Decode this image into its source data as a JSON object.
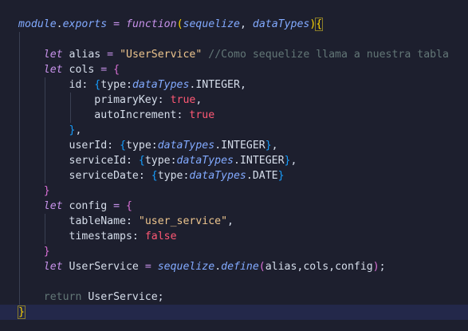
{
  "editor": {
    "lines": [
      {
        "tokens": [
          {
            "t": "module",
            "c": "module"
          },
          {
            "t": ".",
            "c": "plain"
          },
          {
            "t": "exports",
            "c": "module"
          },
          {
            "t": " ",
            "c": "plain"
          },
          {
            "t": "=",
            "c": "op"
          },
          {
            "t": " ",
            "c": "plain"
          },
          {
            "t": "function",
            "c": "kw"
          },
          {
            "t": "(",
            "c": "brace"
          },
          {
            "t": "sequelize",
            "c": "param"
          },
          {
            "t": ", ",
            "c": "plain"
          },
          {
            "t": "dataTypes",
            "c": "param"
          },
          {
            "t": ")",
            "c": "brace"
          },
          {
            "t": "{",
            "c": "bracket-hl"
          }
        ]
      },
      {
        "tokens": []
      },
      {
        "tokens": [
          {
            "t": "    ",
            "c": "plain"
          },
          {
            "t": "let",
            "c": "kw"
          },
          {
            "t": " alias ",
            "c": "plain"
          },
          {
            "t": "=",
            "c": "op"
          },
          {
            "t": " ",
            "c": "plain"
          },
          {
            "t": "\"UserService\"",
            "c": "str"
          },
          {
            "t": " ",
            "c": "plain"
          },
          {
            "t": "//Como sequelize llama a nuestra tabla",
            "c": "comment"
          }
        ]
      },
      {
        "tokens": [
          {
            "t": "    ",
            "c": "plain"
          },
          {
            "t": "let",
            "c": "kw"
          },
          {
            "t": " cols ",
            "c": "plain"
          },
          {
            "t": "=",
            "c": "op"
          },
          {
            "t": " ",
            "c": "plain"
          },
          {
            "t": "{",
            "c": "brace2"
          }
        ]
      },
      {
        "tokens": [
          {
            "t": "        ",
            "c": "plain"
          },
          {
            "t": "id: ",
            "c": "prop"
          },
          {
            "t": "{",
            "c": "brace3"
          },
          {
            "t": "type:",
            "c": "prop"
          },
          {
            "t": "dataTypes",
            "c": "param"
          },
          {
            "t": ".INTEGER,",
            "c": "plain"
          }
        ]
      },
      {
        "tokens": [
          {
            "t": "            ",
            "c": "plain"
          },
          {
            "t": "primaryKey: ",
            "c": "prop"
          },
          {
            "t": "true",
            "c": "bool"
          },
          {
            "t": ",",
            "c": "plain"
          }
        ]
      },
      {
        "tokens": [
          {
            "t": "            ",
            "c": "plain"
          },
          {
            "t": "autoIncrement: ",
            "c": "prop"
          },
          {
            "t": "true",
            "c": "bool"
          }
        ]
      },
      {
        "tokens": [
          {
            "t": "        ",
            "c": "plain"
          },
          {
            "t": "}",
            "c": "brace3"
          },
          {
            "t": ",",
            "c": "plain"
          }
        ]
      },
      {
        "tokens": [
          {
            "t": "        ",
            "c": "plain"
          },
          {
            "t": "userId: ",
            "c": "prop"
          },
          {
            "t": "{",
            "c": "brace3"
          },
          {
            "t": "type:",
            "c": "prop"
          },
          {
            "t": "dataTypes",
            "c": "param"
          },
          {
            "t": ".INTEGER",
            "c": "plain"
          },
          {
            "t": "}",
            "c": "brace3"
          },
          {
            "t": ",",
            "c": "plain"
          }
        ]
      },
      {
        "tokens": [
          {
            "t": "        ",
            "c": "plain"
          },
          {
            "t": "serviceId: ",
            "c": "prop"
          },
          {
            "t": "{",
            "c": "brace3"
          },
          {
            "t": "type:",
            "c": "prop"
          },
          {
            "t": "dataTypes",
            "c": "param"
          },
          {
            "t": ".INTEGER",
            "c": "plain"
          },
          {
            "t": "}",
            "c": "brace3"
          },
          {
            "t": ",",
            "c": "plain"
          }
        ]
      },
      {
        "tokens": [
          {
            "t": "        ",
            "c": "plain"
          },
          {
            "t": "serviceDate: ",
            "c": "prop"
          },
          {
            "t": "{",
            "c": "brace3"
          },
          {
            "t": "type:",
            "c": "prop"
          },
          {
            "t": "dataTypes",
            "c": "param"
          },
          {
            "t": ".DATE",
            "c": "plain"
          },
          {
            "t": "}",
            "c": "brace3"
          }
        ]
      },
      {
        "tokens": [
          {
            "t": "    ",
            "c": "plain"
          },
          {
            "t": "}",
            "c": "brace2"
          }
        ]
      },
      {
        "tokens": [
          {
            "t": "    ",
            "c": "plain"
          },
          {
            "t": "let",
            "c": "kw"
          },
          {
            "t": " config ",
            "c": "plain"
          },
          {
            "t": "=",
            "c": "op"
          },
          {
            "t": " ",
            "c": "plain"
          },
          {
            "t": "{",
            "c": "brace2"
          }
        ]
      },
      {
        "tokens": [
          {
            "t": "        ",
            "c": "plain"
          },
          {
            "t": "tableName: ",
            "c": "prop"
          },
          {
            "t": "\"user_service\"",
            "c": "str"
          },
          {
            "t": ",",
            "c": "plain"
          }
        ]
      },
      {
        "tokens": [
          {
            "t": "        ",
            "c": "plain"
          },
          {
            "t": "timestamps: ",
            "c": "prop"
          },
          {
            "t": "false",
            "c": "bool"
          }
        ]
      },
      {
        "tokens": [
          {
            "t": "    ",
            "c": "plain"
          },
          {
            "t": "}",
            "c": "brace2"
          }
        ]
      },
      {
        "tokens": [
          {
            "t": "    ",
            "c": "plain"
          },
          {
            "t": "let",
            "c": "kw"
          },
          {
            "t": " UserService ",
            "c": "plain"
          },
          {
            "t": "=",
            "c": "op"
          },
          {
            "t": " ",
            "c": "plain"
          },
          {
            "t": "sequelize",
            "c": "param"
          },
          {
            "t": ".",
            "c": "plain"
          },
          {
            "t": "define",
            "c": "fn"
          },
          {
            "t": "(",
            "c": "brace2"
          },
          {
            "t": "alias,cols,config",
            "c": "plain"
          },
          {
            "t": ")",
            "c": "brace2"
          },
          {
            "t": ";",
            "c": "plain"
          }
        ]
      },
      {
        "tokens": []
      },
      {
        "tokens": [
          {
            "t": "    ",
            "c": "plain"
          },
          {
            "t": "return",
            "c": "ret"
          },
          {
            "t": " UserService;",
            "c": "plain"
          }
        ]
      },
      {
        "tokens": [
          {
            "t": "}",
            "c": "bracket-hl"
          }
        ],
        "current": true
      }
    ]
  },
  "colors": {
    "background": "#1d1f2e",
    "current_line": "#23284a",
    "keyword": "#c792ea",
    "string": "#ecc48d",
    "comment": "#637777",
    "boolean": "#ff5874",
    "function": "#82aaff",
    "text": "#d6deeb"
  }
}
